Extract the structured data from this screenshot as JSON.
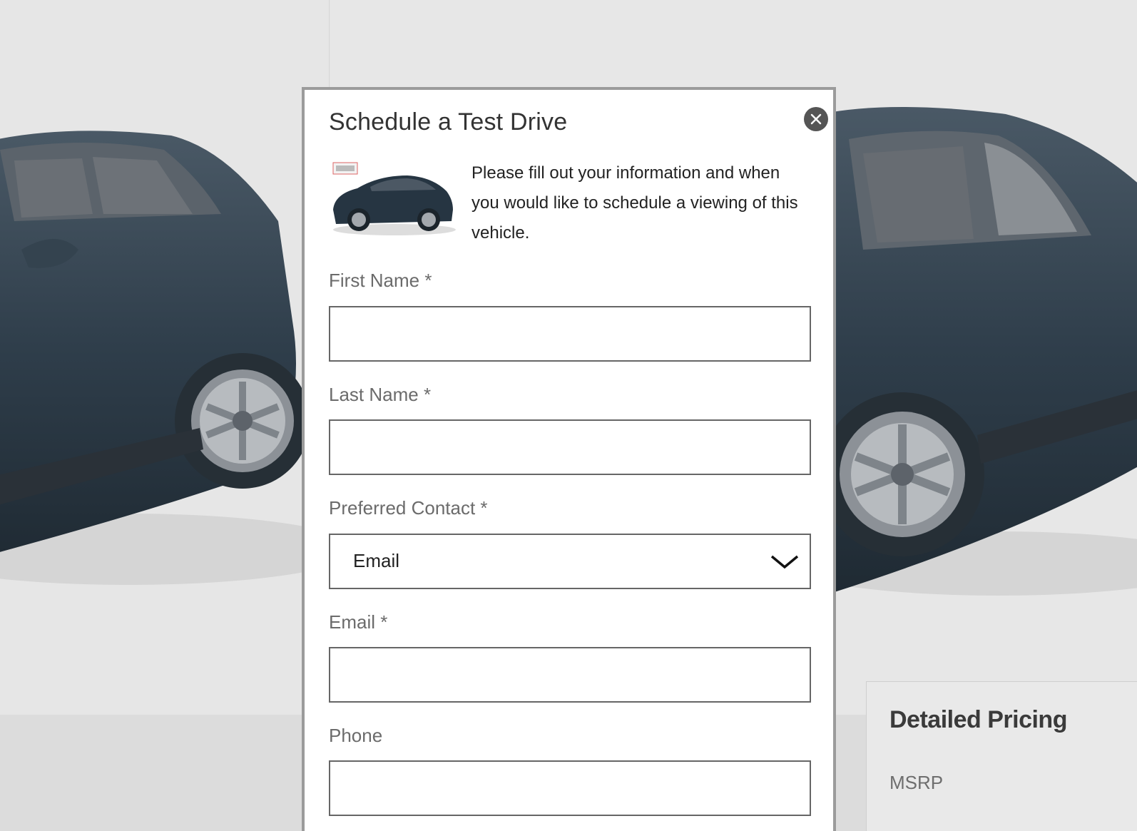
{
  "background": {
    "pricing": {
      "title": "Detailed Pricing",
      "msrp_label": "MSRP"
    }
  },
  "modal": {
    "title": "Schedule a Test Drive",
    "intro": "Please fill out your information and when you would like to schedule a viewing of this vehicle.",
    "fields": {
      "first_name": {
        "label": "First Name *",
        "value": ""
      },
      "last_name": {
        "label": "Last Name *",
        "value": ""
      },
      "preferred_contact": {
        "label": "Preferred Contact *",
        "selected": "Email"
      },
      "email": {
        "label": "Email *",
        "value": ""
      },
      "phone": {
        "label": "Phone",
        "value": ""
      }
    }
  },
  "colors": {
    "car_body": "#2e3e4c",
    "modal_border": "#9b9b9b",
    "close_button": "#555555"
  }
}
